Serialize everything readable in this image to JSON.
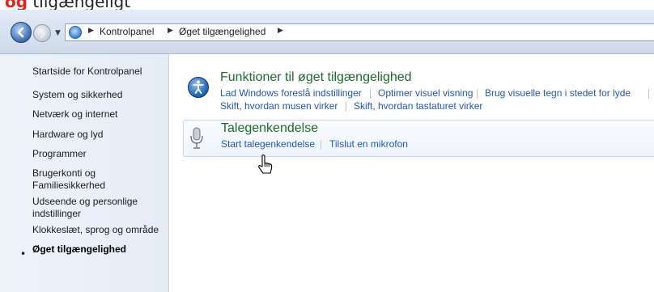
{
  "top_strip": {
    "red_text": "og",
    "rest_text": "tilgængeligt"
  },
  "addressbar": {
    "back_icon": "back-arrow-icon",
    "forward_icon": "forward-arrow-icon",
    "breadcrumbs": [
      "Kontrolpanel",
      "Øget tilgængelighed"
    ]
  },
  "sidebar": {
    "items": [
      {
        "label": "Startside for Kontrolpanel"
      },
      {
        "label": "System og sikkerhed"
      },
      {
        "label": "Netværk og internet"
      },
      {
        "label": "Hardware og lyd"
      },
      {
        "label": "Programmer"
      },
      {
        "label": "Brugerkonti og Familiesikkerhed"
      },
      {
        "label": "Udseende og personlige indstillinger"
      },
      {
        "label": "Klokkeslæt, sprog og område"
      },
      {
        "label": "Øget tilgængelighed",
        "active": true
      }
    ]
  },
  "categories": [
    {
      "title": "Funktioner til øget tilgængelighed",
      "icon": "accessibility-center-icon",
      "links": [
        "Lad Windows foreslå indstillinger",
        "Optimer visuel visning",
        "Brug visuelle tegn i stedet for lyde",
        "Skift, hvordan musen virker",
        "Skift, hvordan tastaturet virker"
      ]
    },
    {
      "title": "Talegenkendelse",
      "icon": "microphone-icon",
      "links": [
        "Start talegenkendelse",
        "Tilslut en mikrofon"
      ]
    }
  ],
  "colors": {
    "link": "#1f57b8",
    "category_title": "#1e6b2a"
  }
}
